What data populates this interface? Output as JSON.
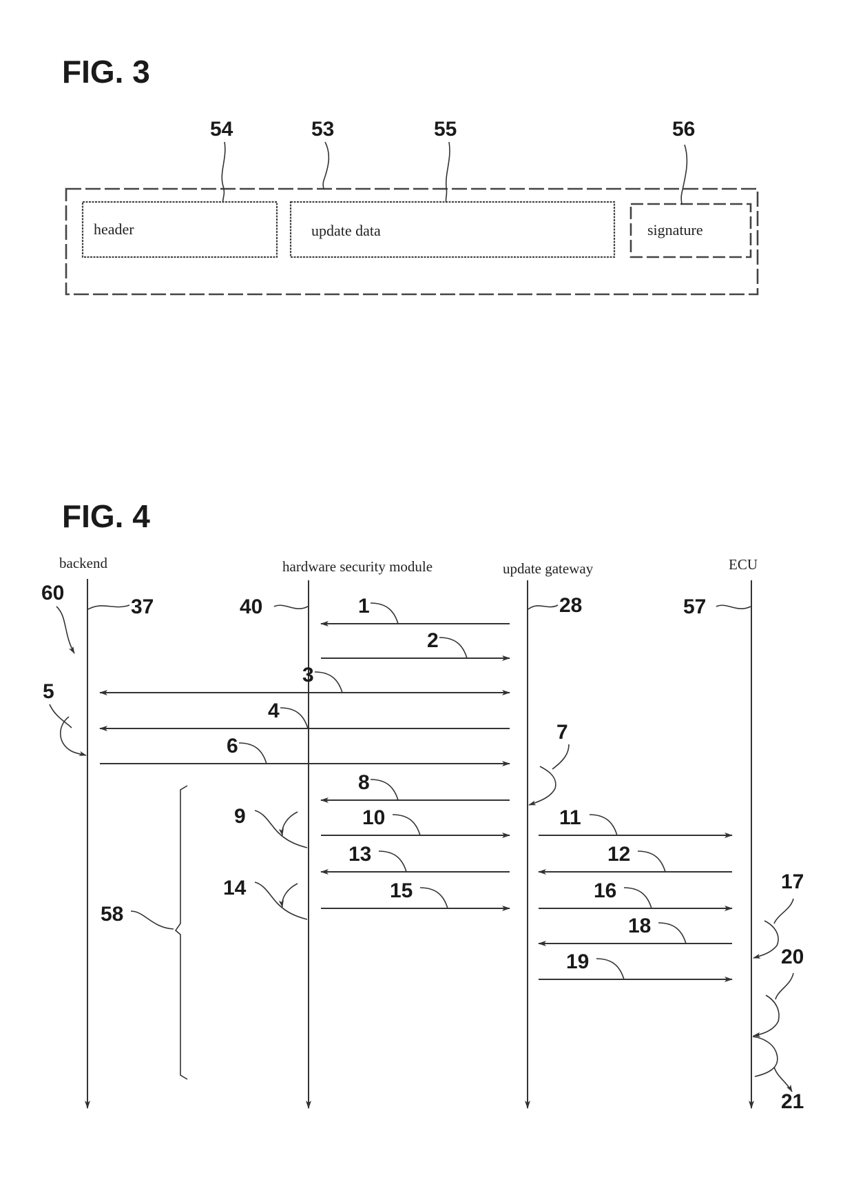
{
  "fig3": {
    "title": "FIG. 3",
    "refs": {
      "outer": "53",
      "header": "54",
      "update": "55",
      "signature": "56"
    },
    "fields": {
      "header": "header",
      "update": "update data",
      "signature": "signature"
    }
  },
  "fig4": {
    "title": "FIG. 4",
    "lanes": [
      {
        "id": "backend",
        "label": "backend",
        "ref": "37"
      },
      {
        "id": "hsm",
        "label": "hardware security module",
        "ref": "40"
      },
      {
        "id": "gateway",
        "label": "update gateway",
        "ref": "28"
      },
      {
        "id": "ecu",
        "label": "ECU",
        "ref": "57"
      }
    ],
    "method_ref": "60",
    "bracket_ref": "58",
    "messages": [
      {
        "step": "1",
        "from": "gateway",
        "to": "hsm"
      },
      {
        "step": "2",
        "from": "hsm",
        "to": "gateway"
      },
      {
        "step": "3",
        "from": "backend",
        "to": "gateway",
        "bidirectional": true
      },
      {
        "step": "4",
        "from": "gateway",
        "to": "backend"
      },
      {
        "step": "6",
        "from": "backend",
        "to": "gateway"
      },
      {
        "step": "8",
        "from": "gateway",
        "to": "hsm"
      },
      {
        "step": "10",
        "from": "hsm",
        "to": "gateway"
      },
      {
        "step": "11",
        "from": "gateway",
        "to": "ecu"
      },
      {
        "step": "12",
        "from": "ecu",
        "to": "gateway"
      },
      {
        "step": "13",
        "from": "gateway",
        "to": "hsm"
      },
      {
        "step": "15",
        "from": "hsm",
        "to": "gateway"
      },
      {
        "step": "16",
        "from": "gateway",
        "to": "ecu"
      },
      {
        "step": "18",
        "from": "ecu",
        "to": "gateway"
      },
      {
        "step": "19",
        "from": "gateway",
        "to": "ecu"
      }
    ],
    "self_steps": [
      {
        "step": "5",
        "lane": "backend"
      },
      {
        "step": "7",
        "lane": "gateway"
      },
      {
        "step": "9",
        "lane": "hsm"
      },
      {
        "step": "14",
        "lane": "hsm"
      },
      {
        "step": "17",
        "lane": "ecu"
      },
      {
        "step": "20",
        "lane": "ecu"
      },
      {
        "step": "21",
        "lane": "ecu"
      }
    ]
  }
}
